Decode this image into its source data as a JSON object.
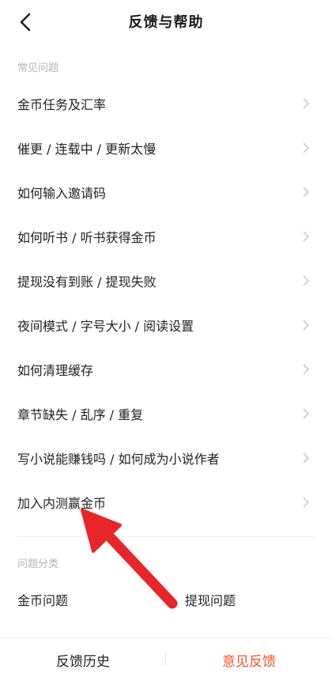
{
  "header": {
    "title": "反馈与帮助",
    "back_icon": "chevron-left-icon"
  },
  "faq": {
    "section_label": "常见问题",
    "items": [
      {
        "label": "金币任务及汇率"
      },
      {
        "label": "催更 / 连载中 / 更新太慢"
      },
      {
        "label": "如何输入邀请码"
      },
      {
        "label": "如何听书 / 听书获得金币"
      },
      {
        "label": "提现没有到账 / 提现失败"
      },
      {
        "label": "夜间模式 / 字号大小 / 阅读设置"
      },
      {
        "label": "如何清理缓存"
      },
      {
        "label": "章节缺失 / 乱序 / 重复"
      },
      {
        "label": "写小说能赚钱吗 / 如何成为小说作者"
      },
      {
        "label": "加入内测赢金币"
      }
    ]
  },
  "categories": {
    "section_label": "问题分类",
    "items": [
      {
        "label": "金币问题"
      },
      {
        "label": "提现问题"
      }
    ]
  },
  "bottom_bar": {
    "history_label": "反馈历史",
    "feedback_label": "意见反馈"
  },
  "colors": {
    "accent": "#f0542d",
    "annotation_arrow": "#e8262a",
    "muted_text": "#b4b4b4",
    "chevron": "#cccccc"
  }
}
